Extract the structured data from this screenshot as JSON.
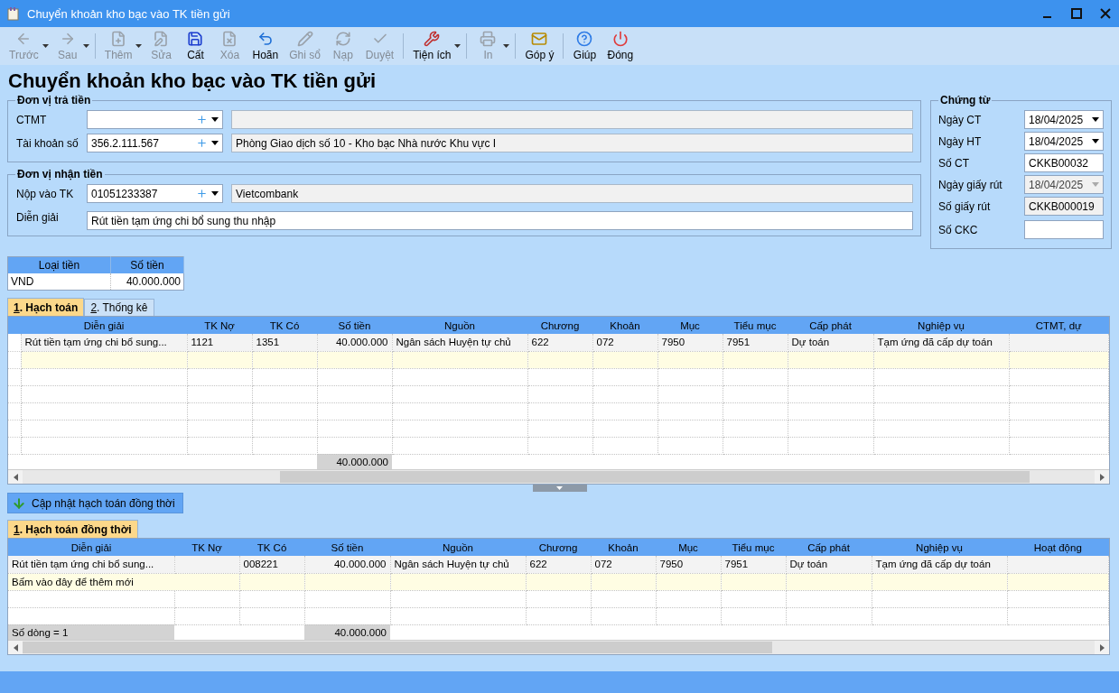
{
  "window": {
    "title": "Chuyển khoản kho bạc vào TK tiền gửi"
  },
  "toolbar": {
    "groups": [
      [
        {
          "label": "Trước",
          "kind": "back",
          "disabled": true,
          "dropdown": true
        },
        {
          "label": "Sau",
          "kind": "forward",
          "disabled": true,
          "dropdown": true
        }
      ],
      [
        {
          "label": "Thêm",
          "kind": "add",
          "disabled": true,
          "dropdown": true
        },
        {
          "label": "Sửa",
          "kind": "edit",
          "disabled": true,
          "dropdown": false
        },
        {
          "label": "Cất",
          "kind": "save",
          "disabled": false,
          "dropdown": false
        },
        {
          "label": "Xóa",
          "kind": "delete",
          "disabled": true,
          "dropdown": false
        },
        {
          "label": "Hoãn",
          "kind": "undo",
          "disabled": false,
          "dropdown": false
        },
        {
          "label": "Ghi sổ",
          "kind": "post",
          "disabled": true,
          "dropdown": false
        },
        {
          "label": "Nạp",
          "kind": "reload",
          "disabled": true,
          "dropdown": false
        },
        {
          "label": "Duyệt",
          "kind": "approve",
          "disabled": true,
          "dropdown": false
        }
      ],
      [
        {
          "label": "Tiện ích",
          "kind": "tools",
          "disabled": false,
          "dropdown": true
        }
      ],
      [
        {
          "label": "In",
          "kind": "print",
          "disabled": true,
          "dropdown": true
        }
      ],
      [
        {
          "label": "Góp ý",
          "kind": "feedback",
          "disabled": false,
          "dropdown": false
        }
      ],
      [
        {
          "label": "Giúp",
          "kind": "help",
          "disabled": false,
          "dropdown": false
        },
        {
          "label": "Đóng",
          "kind": "close",
          "disabled": false,
          "dropdown": false
        }
      ]
    ]
  },
  "heading": "Chuyển khoản kho bạc vào TK tiền gửi",
  "payer": {
    "legend": "Đơn vị trả tiền",
    "fields": [
      {
        "label": "CTMT",
        "kind": "lookup"
      },
      {
        "label": "Tài khoản số",
        "kind": "lookup",
        "value": "356.2.111.567",
        "detail": "Phòng Giao dịch số 10 - Kho bạc Nhà nước Khu vực I"
      }
    ]
  },
  "receiver": {
    "legend": "Đơn vị nhận tiền",
    "fields": [
      {
        "label": "Nộp vào TK",
        "kind": "lookup",
        "value": "01051233387",
        "detail": "Vietcombank"
      },
      {
        "label": "Diễn giải",
        "kind": "text",
        "value": "Rút tiền tạm ứng chi bổ sung thu nhập"
      }
    ]
  },
  "voucher": {
    "legend": "Chứng từ",
    "fields": [
      {
        "label": "Ngày CT",
        "kind": "date",
        "value": "18/04/2025",
        "disabled": false
      },
      {
        "label": "Ngày HT",
        "kind": "date",
        "value": "18/04/2025",
        "disabled": false
      },
      {
        "label": "Số CT",
        "kind": "text",
        "value": "CKKB00032",
        "disabled": false
      },
      {
        "label": "Ngày giấy rút",
        "kind": "date",
        "value": "18/04/2025",
        "disabled": true
      },
      {
        "label": "Số giấy rút",
        "kind": "text",
        "value": "CKKB000019",
        "disabled": true
      },
      {
        "label": "Số CKC",
        "kind": "text",
        "disabled": false
      }
    ]
  },
  "currency_table": {
    "columns": [
      "Loại tiền",
      "Số tiền"
    ],
    "rows": [
      [
        "VND",
        "40.000.000"
      ]
    ]
  },
  "tabs": [
    {
      "label": "1. Hạch toán",
      "selected": true
    },
    {
      "label": "2. Thống kê",
      "selected": false
    }
  ],
  "grid": {
    "columns": [
      {
        "label": "Diễn giải",
        "kind": "text"
      },
      {
        "label": "TK Nợ",
        "kind": "text"
      },
      {
        "label": "TK Có",
        "kind": "text"
      },
      {
        "label": "Số tiền",
        "kind": "amount"
      },
      {
        "label": "Nguồn",
        "kind": "text"
      },
      {
        "label": "Chương",
        "kind": "text"
      },
      {
        "label": "Khoản",
        "kind": "text"
      },
      {
        "label": "Mục",
        "kind": "text"
      },
      {
        "label": "Tiểu mục",
        "kind": "text"
      },
      {
        "label": "Cấp phát",
        "kind": "text"
      },
      {
        "label": "Nghiệp vụ",
        "kind": "text"
      },
      {
        "label": "CTMT, dự",
        "kind": "text"
      }
    ],
    "rows": [
      [
        "Rút tiền tạm ứng chi bổ sung...",
        "1121",
        "1351",
        "40.000.000",
        "Ngân sách Huyện tự chủ",
        "622",
        "072",
        "7950",
        "7951",
        "Dự toán",
        "Tạm ứng đã cấp dự toán",
        null
      ]
    ],
    "footer": {
      "total": "40.000.000"
    }
  },
  "update_button": {
    "label": "Cập nhật hạch toán đồng thời"
  },
  "tabs_2": [
    {
      "label": "1. Hạch toán đồng thời",
      "selected": true
    }
  ],
  "grid_2": {
    "columns": [
      {
        "label": "Diễn giải",
        "kind": "text"
      },
      {
        "label": "TK Nợ",
        "kind": "text"
      },
      {
        "label": "TK Có",
        "kind": "text"
      },
      {
        "label": "Số tiền",
        "kind": "amount"
      },
      {
        "label": "Nguồn",
        "kind": "text"
      },
      {
        "label": "Chương",
        "kind": "text"
      },
      {
        "label": "Khoản",
        "kind": "text"
      },
      {
        "label": "Mục",
        "kind": "text"
      },
      {
        "label": "Tiểu mục",
        "kind": "text"
      },
      {
        "label": "Cấp phát",
        "kind": "text"
      },
      {
        "label": "Nghiệp vụ",
        "kind": "text"
      },
      {
        "label": "Hoạt động",
        "kind": "text"
      }
    ],
    "rows": [
      [
        "Rút tiền tạm ứng chi bổ sung...",
        null,
        "008221",
        "40.000.000",
        "Ngân sách Huyện tự chủ",
        "622",
        "072",
        "7950",
        "7951",
        "Dự toán",
        "Tạm ứng đã cấp dự toán",
        null
      ]
    ],
    "new_row_hint": "Bấm vào đây để thêm mới",
    "footer": {
      "count": "Số dòng = 1",
      "total": "40.000.000"
    }
  }
}
